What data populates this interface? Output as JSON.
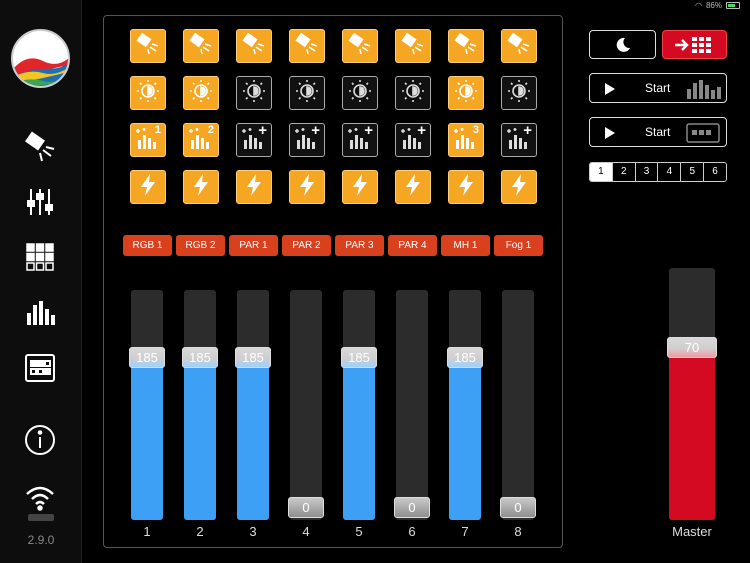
{
  "status": {
    "time": "",
    "battery": "86%"
  },
  "sidebar": {
    "version": "2.9.0",
    "items": [
      {
        "name": "spotlight-icon"
      },
      {
        "name": "faders-icon"
      },
      {
        "name": "grid-icon"
      },
      {
        "name": "equalizer-icon"
      },
      {
        "name": "chaser-icon"
      },
      {
        "name": "info-icon"
      },
      {
        "name": "wifi-icon"
      }
    ]
  },
  "grid": {
    "rows": [
      {
        "type": "spot",
        "states": [
          true,
          true,
          true,
          true,
          true,
          true,
          true,
          true
        ]
      },
      {
        "type": "dimmer",
        "states": [
          true,
          true,
          false,
          false,
          false,
          false,
          true,
          false
        ]
      },
      {
        "type": "preset",
        "states": [
          true,
          true,
          false,
          false,
          false,
          false,
          true,
          false
        ],
        "numbers": [
          "1",
          "2",
          "+",
          "+",
          "+",
          "+",
          "3",
          "+"
        ]
      },
      {
        "type": "flash",
        "states": [
          true,
          true,
          true,
          true,
          true,
          true,
          true,
          true
        ]
      }
    ]
  },
  "channels": [
    {
      "label": "RGB 1",
      "value": 185,
      "num": "1"
    },
    {
      "label": "RGB 2",
      "value": 185,
      "num": "2"
    },
    {
      "label": "PAR 1",
      "value": 185,
      "num": "3"
    },
    {
      "label": "PAR 2",
      "value": 0,
      "num": "4"
    },
    {
      "label": "PAR 3",
      "value": 185,
      "num": "5"
    },
    {
      "label": "PAR 4",
      "value": 0,
      "num": "6"
    },
    {
      "label": "MH 1",
      "value": 185,
      "num": "7"
    },
    {
      "label": "Fog 1",
      "value": 0,
      "num": "8"
    }
  ],
  "right": {
    "start1": "Start",
    "start2": "Start",
    "pages": [
      "1",
      "2",
      "3",
      "4",
      "5",
      "6"
    ],
    "master_label": "Master",
    "master_value": 70
  },
  "colors": {
    "accent": "#f5a623",
    "label_red": "#d9411e",
    "fader_blue": "#3ea0f5",
    "master_red": "#d30a22"
  }
}
